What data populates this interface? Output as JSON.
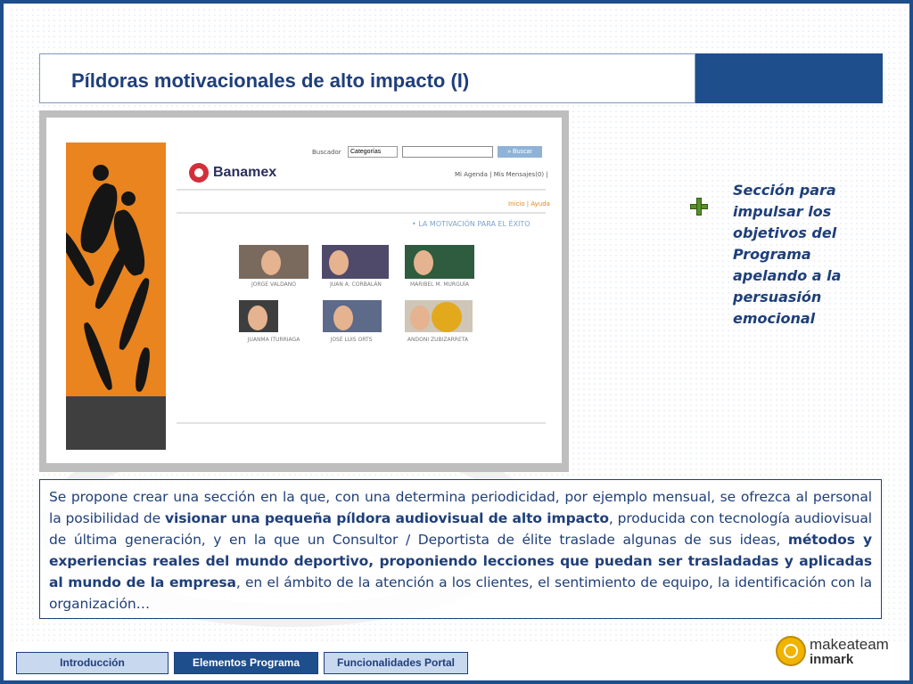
{
  "slide": {
    "title": "Píldoras motivacionales de alto impacto (I)",
    "colors": {
      "primary": "#1f4e8c",
      "text": "#1f3f7a",
      "nav_light": "#c8d8ef",
      "plus": "#5a8f2a"
    }
  },
  "screenshot": {
    "brand": "Banamex",
    "search_label": "Buscador",
    "category_select": "Categorías",
    "search_button": "» Buscar",
    "user_links": "Mi Agenda | Mis Mensajes(0) |",
    "top_links": "Inicio | Ayuda",
    "section_heading": "• LA MOTIVACIÓN PARA EL ÉXITO",
    "people": [
      "JORGE VALDANO",
      "JUAN A. CORBALÁN",
      "MARIBEL M. MURGUÍA",
      "JUANMA ITURRIAGA",
      "JOSÉ LUIS ORTS",
      "ANDONI ZUBIZARRETA"
    ]
  },
  "caption": {
    "icon": "plus-icon",
    "text": "Sección para impulsar los objetivos del Programa apelando a la persuasión emocional"
  },
  "body": {
    "p1": "Se propone crear una sección en la que, con una determina periodicidad, por ejemplo mensual, se ofrezca al personal la posibilidad de ",
    "b1": "visionar una pequeña píldora audiovisual de alto impacto",
    "p2": ", producida con tecnología audiovisual de última generación, y en la que un Consultor / Deportista de élite traslade algunas de sus ideas, ",
    "b2": "métodos y experiencias reales del mundo deportivo, proponiendo lecciones que puedan ser trasladadas y aplicadas al mundo de la empresa",
    "p3": ", en el ámbito de la atención a los clientes, el sentimiento de equipo, la identificación con la organización…"
  },
  "nav": {
    "intro": "Introducción",
    "elementos": "Elementos Programa",
    "funcionalidades": "Funcionalidades Portal"
  },
  "logo": {
    "line1": "makeateam",
    "line2": "inmark"
  }
}
